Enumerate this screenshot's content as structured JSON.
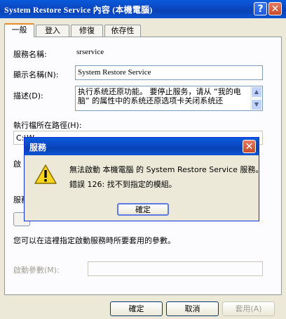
{
  "window": {
    "title": "System Restore Service 內容 (本機電腦)",
    "help_glyph": "?",
    "close_glyph": "✕"
  },
  "tabs": [
    {
      "label": "一般"
    },
    {
      "label": "登入"
    },
    {
      "label": "修復"
    },
    {
      "label": "依存性"
    }
  ],
  "general": {
    "service_name_label": "服務名稱:",
    "service_name_value": "srservice",
    "display_name_label": "顯示名稱(N):",
    "display_name_value": "System Restore Service",
    "description_label": "描述(D):",
    "description_value": "执行系统还原功能。 要停止服务，请从 “我的电脑” 的属性中的系统还原选项卡关闭系统还",
    "path_label": "執行檔所在路徑(H):",
    "path_value": "C:\\W",
    "startup_label": "啟",
    "status_label": "服務",
    "params_hint": "您可以在這裡指定啟動服務時所要套用的參數。",
    "params_label": "啟動參數(M):",
    "params_value": ""
  },
  "footer": {
    "ok": "確定",
    "cancel": "取消",
    "apply": "套用(A)"
  },
  "dialog": {
    "title": "服務",
    "message": "無法啟動 本機電腦 的 System Restore Service 服務。",
    "error": "錯誤 126: 找不到指定的模組。",
    "ok": "確定",
    "close_glyph": "✕",
    "icon": "warning-icon"
  }
}
